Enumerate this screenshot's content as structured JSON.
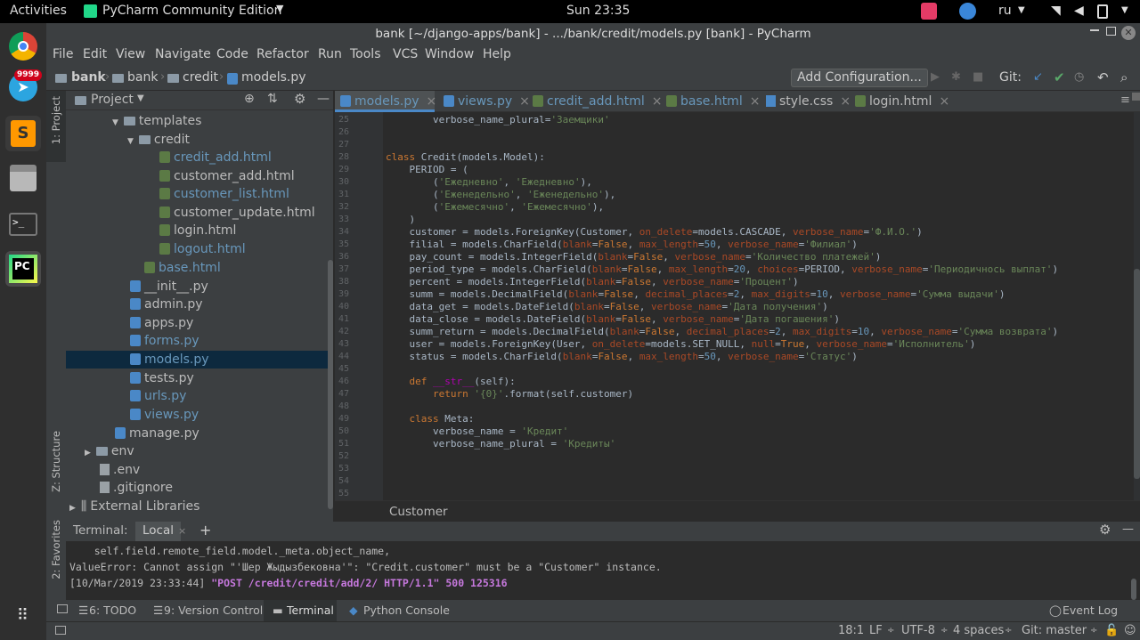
{
  "top_bar": {
    "activities": "Activities",
    "app_name": "PyCharm Community Edition",
    "clock": "Sun 23:35",
    "lang": "ru"
  },
  "dock": {
    "telegram_badge": "9999"
  },
  "window_title": "bank [~/django-apps/bank] - .../bank/credit/models.py [bank] - PyCharm",
  "menu": [
    "File",
    "Edit",
    "View",
    "Navigate",
    "Code",
    "Refactor",
    "Run",
    "Tools",
    "VCS",
    "Window",
    "Help"
  ],
  "navbar": {
    "crumbs": [
      "bank",
      "bank",
      "credit",
      "models.py"
    ],
    "run_config": "Add Configuration...",
    "git_label": "Git:"
  },
  "project_panel": {
    "title": "Project",
    "items": [
      {
        "label": "templates",
        "type": "folder"
      },
      {
        "label": "credit",
        "type": "folder"
      },
      {
        "label": "credit_add.html",
        "type": "html"
      },
      {
        "label": "customer_add.html",
        "type": "html"
      },
      {
        "label": "customer_list.html",
        "type": "html"
      },
      {
        "label": "customer_update.html",
        "type": "html"
      },
      {
        "label": "login.html",
        "type": "html"
      },
      {
        "label": "logout.html",
        "type": "html"
      },
      {
        "label": "base.html",
        "type": "html"
      },
      {
        "label": "__init__.py",
        "type": "py"
      },
      {
        "label": "admin.py",
        "type": "py"
      },
      {
        "label": "apps.py",
        "type": "py"
      },
      {
        "label": "forms.py",
        "type": "py"
      },
      {
        "label": "models.py",
        "type": "py"
      },
      {
        "label": "tests.py",
        "type": "py"
      },
      {
        "label": "urls.py",
        "type": "py"
      },
      {
        "label": "views.py",
        "type": "py"
      },
      {
        "label": "manage.py",
        "type": "py"
      },
      {
        "label": "env",
        "type": "folder"
      },
      {
        "label": ".env",
        "type": "file"
      },
      {
        "label": ".gitignore",
        "type": "file"
      },
      {
        "label": "External Libraries",
        "type": "lib"
      }
    ]
  },
  "left_tool_tabs": {
    "project": "1: Project",
    "structure": "Z: Structure",
    "favorites": "2: Favorites"
  },
  "tabs": [
    "models.py",
    "views.py",
    "credit_add.html",
    "base.html",
    "style.css",
    "login.html"
  ],
  "code": {
    "line_numbers": [
      "25",
      "26",
      "27",
      "28",
      "29",
      "30",
      "31",
      "32",
      "33",
      "34",
      "35",
      "36",
      "37",
      "38",
      "39",
      "40",
      "41",
      "42",
      "43",
      "44",
      "45",
      "46",
      "47",
      "48",
      "49",
      "50",
      "51",
      "52",
      "53",
      "54",
      "55"
    ],
    "lines": [
      [
        {
          "t": "        verbose_name_plural",
          "c": ""
        },
        {
          "t": "=",
          "c": ""
        },
        {
          "t": "'Заемщики'",
          "c": "st"
        }
      ],
      [],
      [],
      [
        {
          "t": "class ",
          "c": "kw"
        },
        {
          "t": "Credit(models.Model):",
          "c": ""
        }
      ],
      [
        {
          "t": "    PERIOD = (",
          "c": ""
        }
      ],
      [
        {
          "t": "        (",
          "c": ""
        },
        {
          "t": "'Ежедневно'",
          "c": "st"
        },
        {
          "t": ", ",
          "c": ""
        },
        {
          "t": "'Ежедневно'",
          "c": "st"
        },
        {
          "t": "),",
          "c": ""
        }
      ],
      [
        {
          "t": "        (",
          "c": ""
        },
        {
          "t": "'Еженедельно'",
          "c": "st"
        },
        {
          "t": ", ",
          "c": ""
        },
        {
          "t": "'Еженедельно'",
          "c": "st"
        },
        {
          "t": "),",
          "c": ""
        }
      ],
      [
        {
          "t": "        (",
          "c": ""
        },
        {
          "t": "'Ежемесячно'",
          "c": "st"
        },
        {
          "t": ", ",
          "c": ""
        },
        {
          "t": "'Ежемесячно'",
          "c": "st"
        },
        {
          "t": "),",
          "c": ""
        }
      ],
      [
        {
          "t": "    )",
          "c": ""
        }
      ],
      [
        {
          "t": "    customer = models.ForeignKey(Customer, ",
          "c": ""
        },
        {
          "t": "on_delete",
          "c": "pr"
        },
        {
          "t": "=models.CASCADE, ",
          "c": ""
        },
        {
          "t": "verbose_name",
          "c": "pr"
        },
        {
          "t": "=",
          "c": ""
        },
        {
          "t": "'Ф.И.О.'",
          "c": "st"
        },
        {
          "t": ")",
          "c": ""
        }
      ],
      [
        {
          "t": "    filial = models.CharField(",
          "c": ""
        },
        {
          "t": "blank",
          "c": "pr"
        },
        {
          "t": "=",
          "c": ""
        },
        {
          "t": "False",
          "c": "kw"
        },
        {
          "t": ", ",
          "c": ""
        },
        {
          "t": "max_length",
          "c": "pr"
        },
        {
          "t": "=",
          "c": ""
        },
        {
          "t": "50",
          "c": "nu"
        },
        {
          "t": ", ",
          "c": ""
        },
        {
          "t": "verbose_name",
          "c": "pr"
        },
        {
          "t": "=",
          "c": ""
        },
        {
          "t": "'Филиал'",
          "c": "st"
        },
        {
          "t": ")",
          "c": ""
        }
      ],
      [
        {
          "t": "    pay_count = models.IntegerField(",
          "c": ""
        },
        {
          "t": "blank",
          "c": "pr"
        },
        {
          "t": "=",
          "c": ""
        },
        {
          "t": "False",
          "c": "kw"
        },
        {
          "t": ", ",
          "c": ""
        },
        {
          "t": "verbose_name",
          "c": "pr"
        },
        {
          "t": "=",
          "c": ""
        },
        {
          "t": "'Количество платежей'",
          "c": "st"
        },
        {
          "t": ")",
          "c": ""
        }
      ],
      [
        {
          "t": "    period_type = models.CharField(",
          "c": ""
        },
        {
          "t": "blank",
          "c": "pr"
        },
        {
          "t": "=",
          "c": ""
        },
        {
          "t": "False",
          "c": "kw"
        },
        {
          "t": ", ",
          "c": ""
        },
        {
          "t": "max_length",
          "c": "pr"
        },
        {
          "t": "=",
          "c": ""
        },
        {
          "t": "20",
          "c": "nu"
        },
        {
          "t": ", ",
          "c": ""
        },
        {
          "t": "choices",
          "c": "pr"
        },
        {
          "t": "=PERIOD, ",
          "c": ""
        },
        {
          "t": "verbose_name",
          "c": "pr"
        },
        {
          "t": "=",
          "c": ""
        },
        {
          "t": "'Периодичнось выплат'",
          "c": "st"
        },
        {
          "t": ")",
          "c": ""
        }
      ],
      [
        {
          "t": "    percent = models.IntegerField(",
          "c": ""
        },
        {
          "t": "blank",
          "c": "pr"
        },
        {
          "t": "=",
          "c": ""
        },
        {
          "t": "False",
          "c": "kw"
        },
        {
          "t": ", ",
          "c": ""
        },
        {
          "t": "verbose_name",
          "c": "pr"
        },
        {
          "t": "=",
          "c": ""
        },
        {
          "t": "'Процент'",
          "c": "st"
        },
        {
          "t": ")",
          "c": ""
        }
      ],
      [
        {
          "t": "    summ = models.DecimalField(",
          "c": ""
        },
        {
          "t": "blank",
          "c": "pr"
        },
        {
          "t": "=",
          "c": ""
        },
        {
          "t": "False",
          "c": "kw"
        },
        {
          "t": ", ",
          "c": ""
        },
        {
          "t": "decimal_places",
          "c": "pr"
        },
        {
          "t": "=",
          "c": ""
        },
        {
          "t": "2",
          "c": "nu"
        },
        {
          "t": ", ",
          "c": ""
        },
        {
          "t": "max_digits",
          "c": "pr"
        },
        {
          "t": "=",
          "c": ""
        },
        {
          "t": "10",
          "c": "nu"
        },
        {
          "t": ", ",
          "c": ""
        },
        {
          "t": "verbose_name",
          "c": "pr"
        },
        {
          "t": "=",
          "c": ""
        },
        {
          "t": "'Сумма выдачи'",
          "c": "st"
        },
        {
          "t": ")",
          "c": ""
        }
      ],
      [
        {
          "t": "    data_get = models.DateField(",
          "c": ""
        },
        {
          "t": "blank",
          "c": "pr"
        },
        {
          "t": "=",
          "c": ""
        },
        {
          "t": "False",
          "c": "kw"
        },
        {
          "t": ", ",
          "c": ""
        },
        {
          "t": "verbose_name",
          "c": "pr"
        },
        {
          "t": "=",
          "c": ""
        },
        {
          "t": "'Дата получения'",
          "c": "st"
        },
        {
          "t": ")",
          "c": ""
        }
      ],
      [
        {
          "t": "    data_close = models.DateField(",
          "c": ""
        },
        {
          "t": "blank",
          "c": "pr"
        },
        {
          "t": "=",
          "c": ""
        },
        {
          "t": "False",
          "c": "kw"
        },
        {
          "t": ", ",
          "c": ""
        },
        {
          "t": "verbose_name",
          "c": "pr"
        },
        {
          "t": "=",
          "c": ""
        },
        {
          "t": "'Дата погашения'",
          "c": "st"
        },
        {
          "t": ")",
          "c": ""
        }
      ],
      [
        {
          "t": "    summ_return = models.DecimalField(",
          "c": ""
        },
        {
          "t": "blank",
          "c": "pr"
        },
        {
          "t": "=",
          "c": ""
        },
        {
          "t": "False",
          "c": "kw"
        },
        {
          "t": ", ",
          "c": ""
        },
        {
          "t": "decimal_places",
          "c": "pr"
        },
        {
          "t": "=",
          "c": ""
        },
        {
          "t": "2",
          "c": "nu"
        },
        {
          "t": ", ",
          "c": ""
        },
        {
          "t": "max_digits",
          "c": "pr"
        },
        {
          "t": "=",
          "c": ""
        },
        {
          "t": "10",
          "c": "nu"
        },
        {
          "t": ", ",
          "c": ""
        },
        {
          "t": "verbose_name",
          "c": "pr"
        },
        {
          "t": "=",
          "c": ""
        },
        {
          "t": "'Сумма возврата'",
          "c": "st"
        },
        {
          "t": ")",
          "c": ""
        }
      ],
      [
        {
          "t": "    user = models.ForeignKey(User, ",
          "c": ""
        },
        {
          "t": "on_delete",
          "c": "pr"
        },
        {
          "t": "=models.SET_NULL, ",
          "c": ""
        },
        {
          "t": "null",
          "c": "pr"
        },
        {
          "t": "=",
          "c": ""
        },
        {
          "t": "True",
          "c": "kw"
        },
        {
          "t": ", ",
          "c": ""
        },
        {
          "t": "verbose_name",
          "c": "pr"
        },
        {
          "t": "=",
          "c": ""
        },
        {
          "t": "'Исполнитель'",
          "c": "st"
        },
        {
          "t": ")",
          "c": ""
        }
      ],
      [
        {
          "t": "    status = models.CharField(",
          "c": ""
        },
        {
          "t": "blank",
          "c": "pr"
        },
        {
          "t": "=",
          "c": ""
        },
        {
          "t": "False",
          "c": "kw"
        },
        {
          "t": ", ",
          "c": ""
        },
        {
          "t": "max_length",
          "c": "pr"
        },
        {
          "t": "=",
          "c": ""
        },
        {
          "t": "50",
          "c": "nu"
        },
        {
          "t": ", ",
          "c": ""
        },
        {
          "t": "verbose_name",
          "c": "pr"
        },
        {
          "t": "=",
          "c": ""
        },
        {
          "t": "'Статус'",
          "c": "st"
        },
        {
          "t": ")",
          "c": ""
        }
      ],
      [],
      [
        {
          "t": "    ",
          "c": ""
        },
        {
          "t": "def ",
          "c": "kw"
        },
        {
          "t": "__str__",
          "c": "fn"
        },
        {
          "t": "(self):",
          "c": ""
        }
      ],
      [
        {
          "t": "        ",
          "c": ""
        },
        {
          "t": "return ",
          "c": "kw"
        },
        {
          "t": "'{0}'",
          "c": "st"
        },
        {
          "t": ".format(self.customer)",
          "c": ""
        }
      ],
      [],
      [
        {
          "t": "    ",
          "c": ""
        },
        {
          "t": "class ",
          "c": "kw"
        },
        {
          "t": "Meta:",
          "c": ""
        }
      ],
      [
        {
          "t": "        verbose_name = ",
          "c": ""
        },
        {
          "t": "'Кредит'",
          "c": "st"
        }
      ],
      [
        {
          "t": "        verbose_name_plural = ",
          "c": ""
        },
        {
          "t": "'Кредиты'",
          "c": "st"
        }
      ],
      [],
      [],
      [],
      []
    ]
  },
  "editor_breadcrumb": "Customer",
  "terminal": {
    "label": "Terminal:",
    "tab": "Local",
    "lines": [
      "    self.field.remote_field.model._meta.object_name,",
      "ValueError: Cannot assign \"'Шер Жыдызбековна'\": \"Credit.customer\" must be a \"Customer\" instance.",
      "[10/Mar/2019 23:33:44] "
    ],
    "request": "\"POST /credit/credit/add/2/ HTTP/1.1\" 500 125316"
  },
  "bottom_tools": {
    "todo": "6: TODO",
    "vc": "9: Version Control",
    "terminal": "Terminal",
    "console": "Python Console",
    "event_log": "Event Log"
  },
  "status": {
    "pos": "18:1",
    "sep": "LF",
    "enc": "UTF-8",
    "indent": "4 spaces",
    "git": "Git: master"
  },
  "colors": {
    "accent": "#4a88c7",
    "selection": "#0d293e",
    "keyword": "#cc7832",
    "string": "#6a8759",
    "param": "#aa4926",
    "number": "#6897bb"
  }
}
